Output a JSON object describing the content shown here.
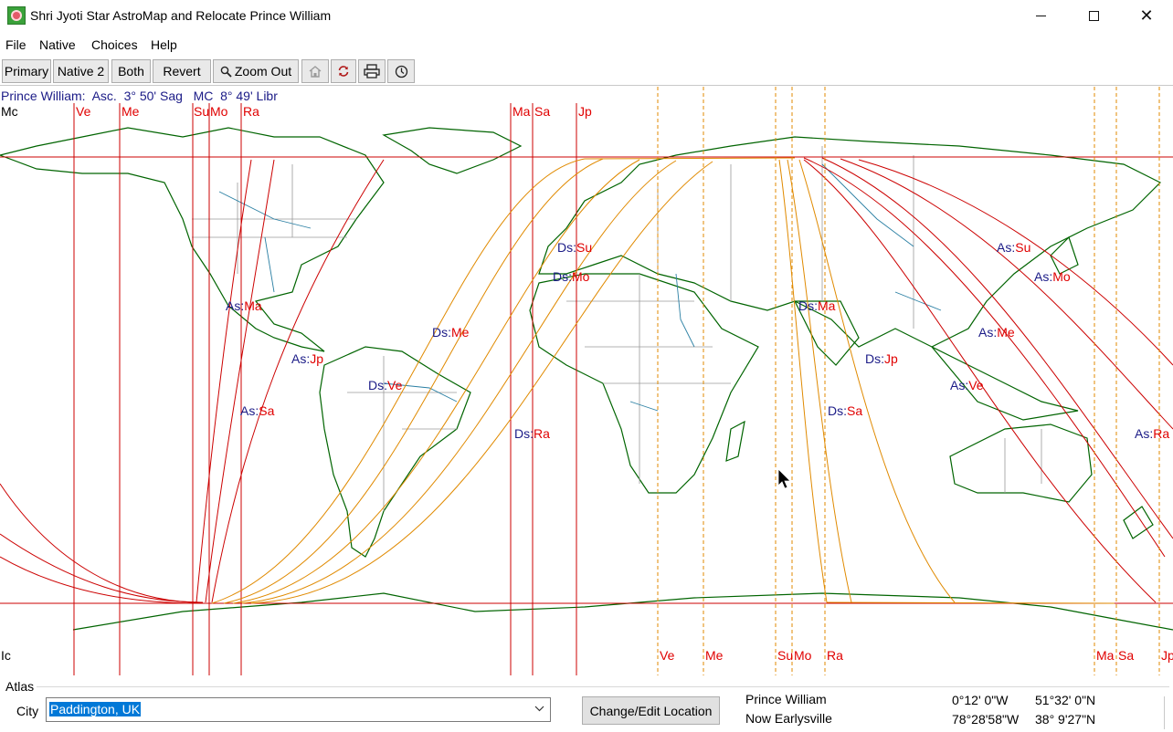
{
  "window": {
    "title": "Shri Jyoti Star AstroMap and Relocate Prince William",
    "app_icon": "astromap-app-icon",
    "controls": [
      "minimize-icon",
      "maximize-icon",
      "close-icon"
    ]
  },
  "menu": {
    "file": "File",
    "native": "Native",
    "choices": "Choices",
    "help": "Help"
  },
  "toolbar": {
    "primary": "Primary",
    "native2": "Native 2",
    "both": "Both",
    "revert": "Revert",
    "zoom_out": "Zoom Out",
    "icons": [
      "zoom-icon",
      "home-icon",
      "refresh-icon",
      "print-icon",
      "clock-icon"
    ]
  },
  "info_line": "Prince William:  Asc.  3° 50' Sag   MC  8° 49' Libr",
  "map": {
    "colors": {
      "land_outline": "#006400",
      "borders": "#9a9a9a",
      "rivers": "#2a7fa3",
      "natal_lines": "#cc0000",
      "relocated_lines": "#e08a00",
      "label_prefix": "#1b1b87",
      "label_planet": "#e00000",
      "background": "#ffffff"
    },
    "mc_label": "Mc",
    "ic_label": "Ic",
    "top_planets": [
      "Ve",
      "Me",
      "Su",
      "Mo",
      "Ra",
      "Ma",
      "Sa",
      "Jp"
    ],
    "bottom_planets": [
      "Ve",
      "Me",
      "Su",
      "Mo",
      "Ra",
      "Ma",
      "Sa",
      "Jp"
    ],
    "line_labels": [
      {
        "prefix": "Ds:",
        "planet": "Su"
      },
      {
        "prefix": "Ds:",
        "planet": "Mo"
      },
      {
        "prefix": "As:",
        "planet": "Ma"
      },
      {
        "prefix": "Ds:",
        "planet": "Me"
      },
      {
        "prefix": "As:",
        "planet": "Jp"
      },
      {
        "prefix": "Ds:",
        "planet": "Ve"
      },
      {
        "prefix": "As:",
        "planet": "Sa"
      },
      {
        "prefix": "Ds:",
        "planet": "Ra"
      },
      {
        "prefix": "Ds:",
        "planet": "Ma"
      },
      {
        "prefix": "Ds:",
        "planet": "Jp"
      },
      {
        "prefix": "Ds:",
        "planet": "Sa"
      },
      {
        "prefix": "As:",
        "planet": "Su"
      },
      {
        "prefix": "As:",
        "planet": "Mo"
      },
      {
        "prefix": "As:",
        "planet": "Me"
      },
      {
        "prefix": "As:",
        "planet": "Ve"
      },
      {
        "prefix": "As:",
        "planet": "Ra"
      }
    ]
  },
  "atlas": {
    "section_label": "Atlas",
    "city_label": "City",
    "city_value": "Paddington, UK",
    "change_button": "Change/Edit Location",
    "native_name": "Prince William",
    "relocation": "Now Earlysville",
    "native_lon": "0°12' 0\"W",
    "native_lat": "51°32' 0\"N",
    "reloc_lon": "78°28'58\"W",
    "reloc_lat": "38° 9'27\"N"
  }
}
